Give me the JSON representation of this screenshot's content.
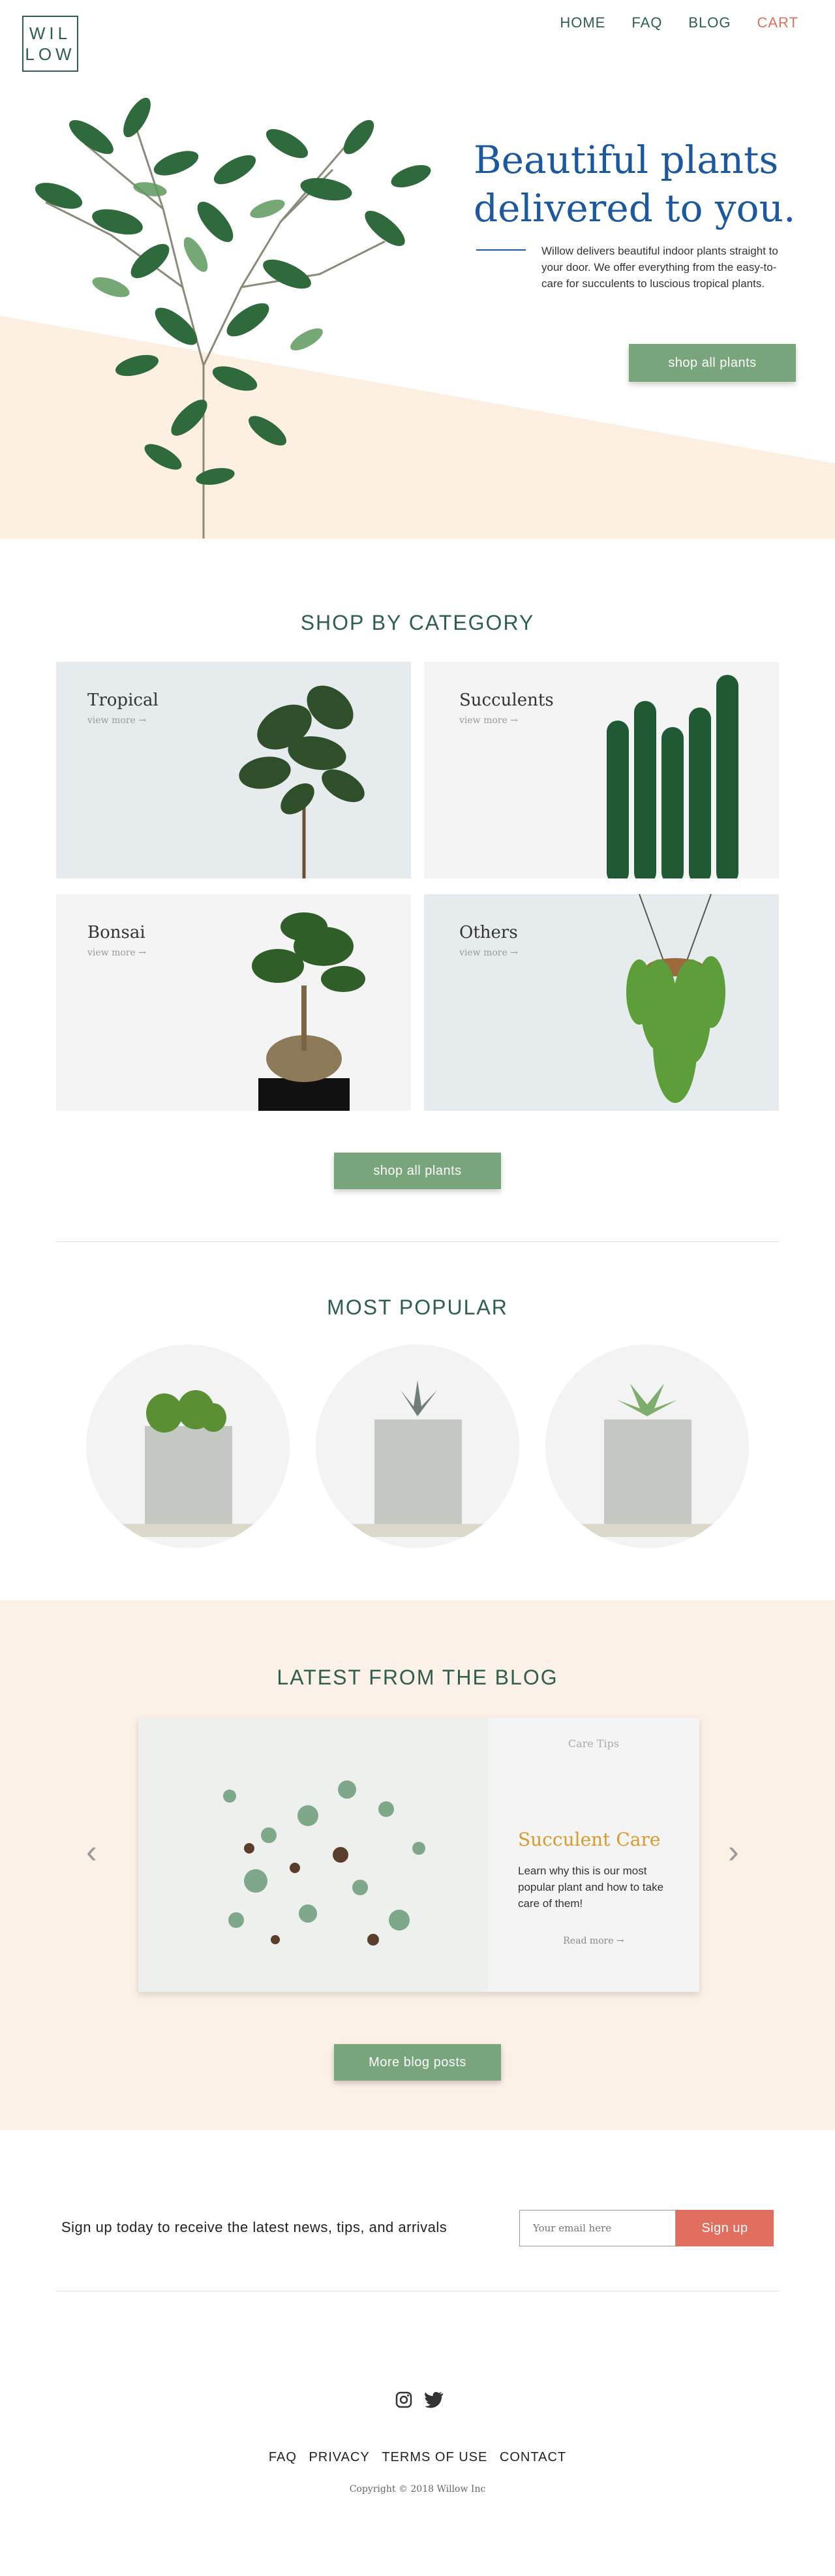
{
  "header": {
    "logo_top": "WIL",
    "logo_bottom": "LOW",
    "nav": [
      "HOME",
      "FAQ",
      "BLOG",
      "CART"
    ]
  },
  "hero": {
    "title": "Beautiful plants delivered to you.",
    "text": "Willow delivers beautiful indoor plants straight to your door. We offer everything from the easy-to-care for succulents to luscious tropical plants.",
    "button": "shop all plants"
  },
  "categories": {
    "heading": "SHOP BY CATEGORY",
    "items": [
      {
        "title": "Tropical",
        "more": "view more  →"
      },
      {
        "title": "Succulents",
        "more": "view more  →"
      },
      {
        "title": "Bonsai",
        "more": "view more  →"
      },
      {
        "title": "Others",
        "more": "view more  →"
      }
    ],
    "button": "shop all plants"
  },
  "popular": {
    "heading": "MOST POPULAR"
  },
  "blog": {
    "heading": "LATEST FROM THE BLOG",
    "tag": "Care Tips",
    "title": "Succulent Care",
    "text": "Learn why this is our most popular plant and how to take care of them!",
    "more": "Read more  →",
    "button": "More blog posts"
  },
  "signup": {
    "text": "Sign up today to receive the latest news, tips, and arrivals",
    "placeholder": "Your email here",
    "button": "Sign up"
  },
  "footer": {
    "links": [
      "FAQ",
      "PRIVACY",
      "TERMS OF USE",
      "CONTACT"
    ],
    "copyright": "Copyright © 2018 Willow Inc"
  },
  "colors": {
    "brand_green": "#2e5e4e",
    "button_green": "#79a57c",
    "accent_coral": "#e06f5f",
    "title_blue": "#1c58a0",
    "peach": "#fbf1e7"
  }
}
